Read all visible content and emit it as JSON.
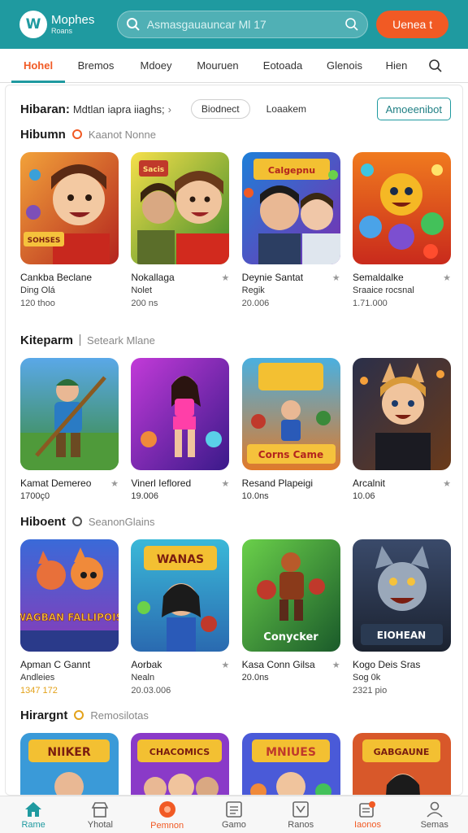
{
  "header": {
    "logo_letter": "W",
    "logo_name": "Mophes",
    "logo_sub": "Roans",
    "search_placeholder": "Asmasgauauncar Ml 17",
    "join_label": "Uenea t",
    "accent": "#1f9aa0",
    "orange": "#f15a24"
  },
  "nav": {
    "items": [
      {
        "label": "Hohel"
      },
      {
        "label": "Bremos"
      },
      {
        "label": "Mdoey"
      },
      {
        "label": "Mouruen"
      },
      {
        "label": "Eotoada"
      },
      {
        "label": "Glenois"
      },
      {
        "label": "Hien"
      }
    ]
  },
  "panel": {
    "title": "Hibaran:",
    "subtitle": "Mdtlan iapra iiaghs;",
    "pill": "Biodnect",
    "tab": "Loaakem",
    "adv_button": "Amoeenibot"
  },
  "sections": [
    {
      "title": "Hibumn",
      "subtitle": "Kaanot Nonne",
      "games": [
        {
          "title": "Cankba Beclane",
          "sub": "Ding Olá",
          "count": "120 thoo",
          "art_text": "SOHSES"
        },
        {
          "title": "Nokallaga",
          "sub": "Nolet",
          "count": "200 ns",
          "art_text": "Sacis"
        },
        {
          "title": "Deynie Santat",
          "sub": "Regik",
          "count": "20.006",
          "art_text": "Calgepnu"
        },
        {
          "title": "Semaldalke",
          "sub": "Sraaice rocsnal",
          "count": "1.71.000",
          "art_text": ""
        }
      ]
    },
    {
      "title": "Kiteparm",
      "subtitle": "Seteark Mlane",
      "games": [
        {
          "title": "Kamat Demereo",
          "sub": "1700ç0",
          "count": "",
          "art_text": ""
        },
        {
          "title": "Vinerl Ieflored",
          "sub": "19.006",
          "count": "",
          "art_text": ""
        },
        {
          "title": "Resand Plapeigi",
          "sub": "10.0ns",
          "count": "",
          "art_text": "Corns Came"
        },
        {
          "title": "Arcalnit",
          "sub": "10.06",
          "count": "",
          "art_text": ""
        }
      ]
    },
    {
      "title": "Hiboent",
      "subtitle": "SeanonGlains",
      "games": [
        {
          "title": "Apman C Gannt",
          "sub": "Andleies",
          "count": "1347 172",
          "art_text": "WAGBAN FALLIPOIS"
        },
        {
          "title": "Aorbak",
          "sub": "Nealn",
          "count": "20.03.006",
          "art_text": "WANAS"
        },
        {
          "title": "Kasa Conn Gilsa",
          "sub": "20.0ns",
          "count": "",
          "art_text": "Conycker"
        },
        {
          "title": "Kogo Deis Sras",
          "sub": "Sog 0k",
          "count": "2321 pio",
          "art_text": "EIOHEAN"
        }
      ]
    },
    {
      "title": "Hirargnt",
      "subtitle": "Remosilotas",
      "games": [
        {
          "art_text": "NIIKER"
        },
        {
          "art_text": "CHACOMICS"
        },
        {
          "art_text": "MNIUES"
        },
        {
          "art_text": "GABGAUNE"
        }
      ]
    }
  ],
  "bottom_nav": [
    {
      "label": "Rame",
      "icon": "home-icon"
    },
    {
      "label": "Yhotal",
      "icon": "store-icon"
    },
    {
      "label": "Pemnon",
      "icon": "record-icon"
    },
    {
      "label": "Gamo",
      "icon": "list-icon"
    },
    {
      "label": "Ranos",
      "icon": "chart-icon"
    },
    {
      "label": "Iaonos",
      "icon": "notification-icon"
    },
    {
      "label": "Semas",
      "icon": "profile-icon"
    }
  ]
}
